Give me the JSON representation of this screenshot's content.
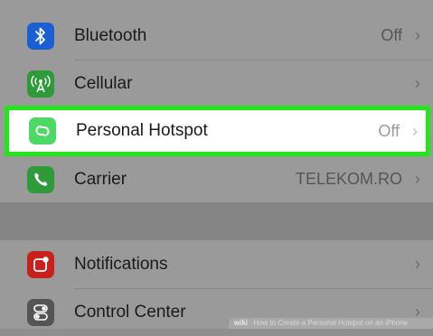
{
  "settings": {
    "rows": [
      {
        "label": "Bluetooth",
        "value": "Off",
        "icon": "bluetooth-icon",
        "icon_color": "#1a5fd4"
      },
      {
        "label": "Cellular",
        "value": "",
        "icon": "cellular-antenna-icon",
        "icon_color": "#2f9a3a"
      },
      {
        "label": "Personal Hotspot",
        "value": "Off",
        "icon": "hotspot-chain-icon",
        "icon_color": "#4cd964"
      },
      {
        "label": "Carrier",
        "value": "TELEKOM.RO",
        "icon": "phone-icon",
        "icon_color": "#2f9a3a"
      },
      {
        "label": "Notifications",
        "value": "",
        "icon": "notifications-icon",
        "icon_color": "#c9201c"
      },
      {
        "label": "Control Center",
        "value": "",
        "icon": "control-center-icon",
        "icon_color": "#555555"
      }
    ],
    "chevron": "›",
    "highlight_color": "#22e51a"
  },
  "watermark": {
    "logo": "wiki",
    "text": "How to Create a Personal Hotspot on an iPhone"
  }
}
